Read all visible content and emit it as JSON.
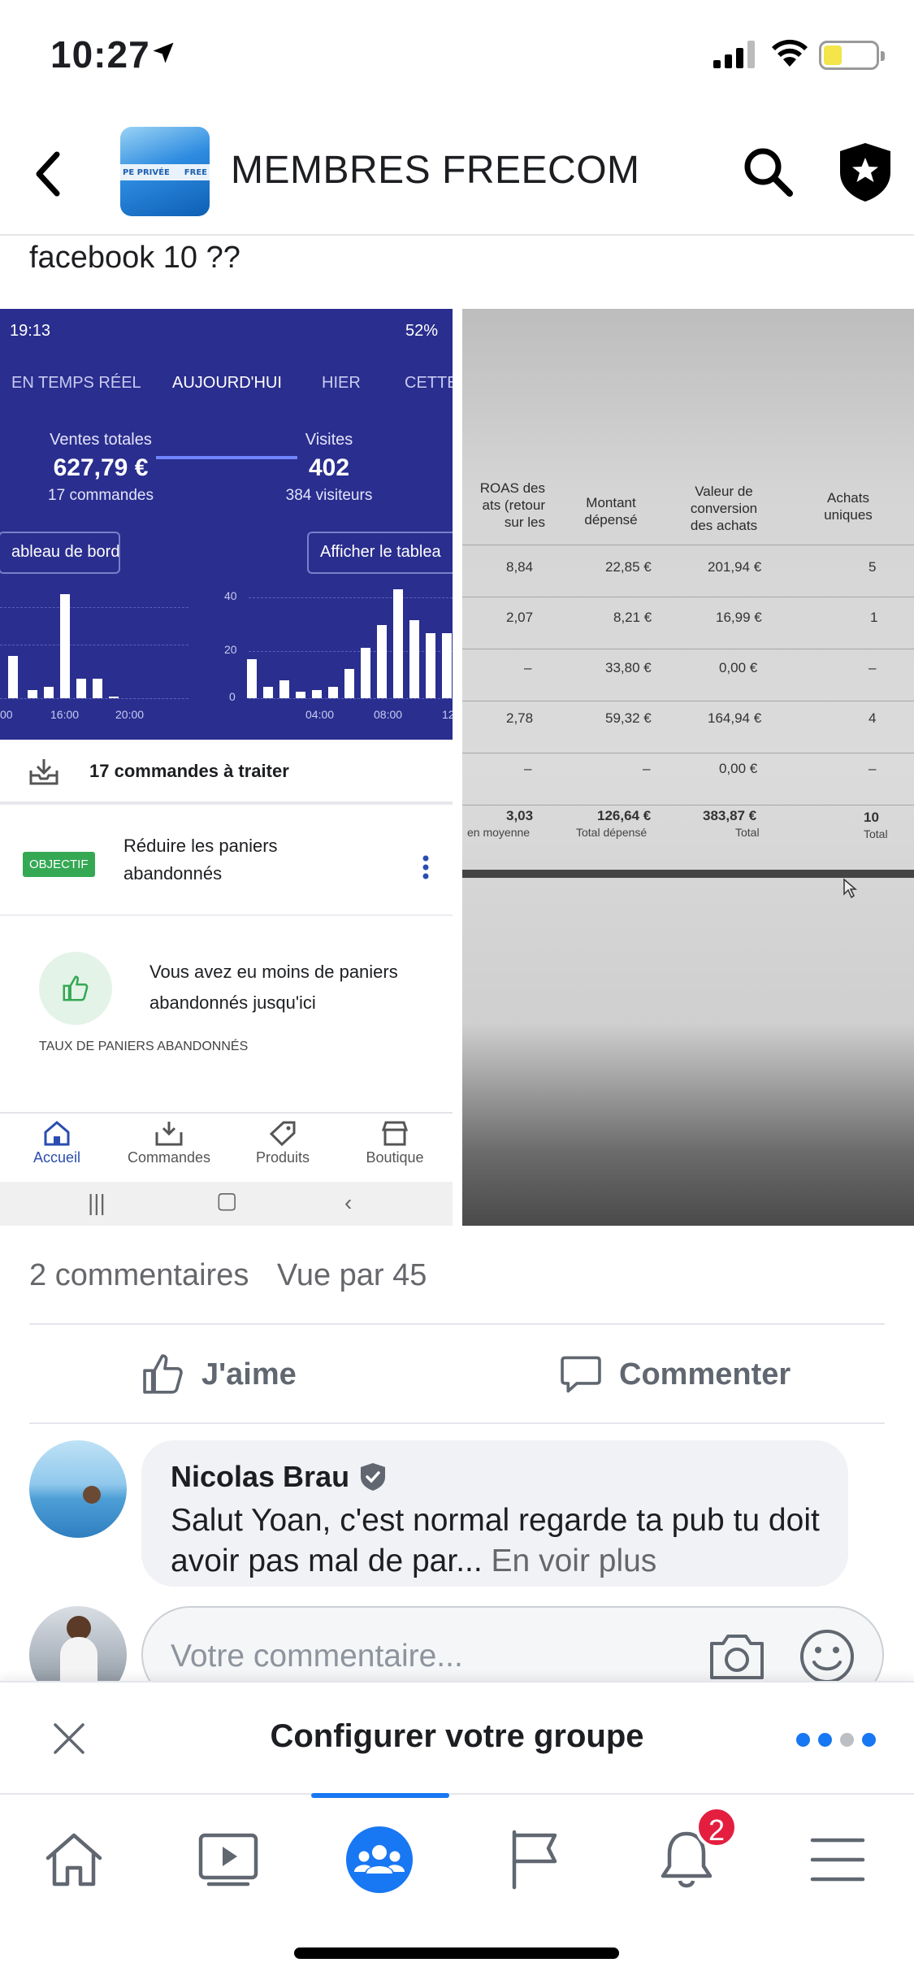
{
  "status_bar": {
    "time": "10:27"
  },
  "header": {
    "group_name": "MEMBRES FREECOM",
    "avatar_text_left": "PE PRIVÉE",
    "avatar_text_right": "FREE"
  },
  "post": {
    "text": "facebook 10 ??",
    "left_screenshot": {
      "status_time": "19:13",
      "status_right": "52%",
      "tabs": [
        "EN TEMPS RÉEL",
        "AUJOURD'HUI",
        "HIER",
        "CETTE"
      ],
      "active_tab": "AUJOURD'HUI",
      "kpi_sales": {
        "label": "Ventes totales",
        "value": "627,79 €",
        "sub": "17 commandes"
      },
      "kpi_visits": {
        "label": "Visites",
        "value": "402",
        "sub": "384 visiteurs"
      },
      "btn_dashboard": "ableau de bord",
      "btn_table": "Afficher le tablea",
      "chart_ticks_left": [
        "00",
        "16:00",
        "20:00"
      ],
      "chart_ticks_right": [
        "04:00",
        "08:00",
        "12"
      ],
      "chart_yaxis": [
        "40",
        "20",
        "0"
      ],
      "orders_to_process": "17 commandes à traiter",
      "goal_badge": "OBJECTIF",
      "goal_text": "Réduire les paniers abandonnés",
      "info_text": "Vous avez eu moins de paniers abandonnés jusqu'ici",
      "rate_label": "TAUX DE PANIERS ABANDONNÉS",
      "nav": [
        "Accueil",
        "Commandes",
        "Produits",
        "Boutique"
      ]
    },
    "right_photo": {
      "headers": [
        "ROAS des\nats (retour\nsur les",
        "Montant\ndépensé",
        "Valeur de\nconversion\ndes achats",
        "Achats\nuniques"
      ],
      "rows": [
        [
          "8,84",
          "22,85 €",
          "201,94 €",
          "5"
        ],
        [
          "2,07",
          "8,21 €",
          "16,99 €",
          "1"
        ],
        [
          "–",
          "33,80 €",
          "0,00 €",
          "–"
        ],
        [
          "2,78",
          "59,32 €",
          "164,94 €",
          "4"
        ],
        [
          "–",
          "–",
          "0,00 €",
          "–"
        ]
      ],
      "totals": [
        "3,03",
        "126,64 €",
        "383,87 €",
        "10"
      ],
      "totals_sub": [
        "en moyenne",
        "Total dépensé",
        "Total",
        "Total"
      ]
    },
    "comment_count": "2 commentaires",
    "views": "Vue par 45",
    "like_label": "J'aime",
    "comment_label": "Commenter"
  },
  "comment": {
    "author": "Nicolas Brau",
    "text": "Salut Yoan, c'est normal regarde ta pub tu doit avoir pas mal de par...",
    "see_more": "En voir plus"
  },
  "composer": {
    "placeholder": "Votre commentaire..."
  },
  "setup_banner": {
    "title": "Configurer votre groupe"
  },
  "tabbar": {
    "notifications_badge": "2"
  },
  "colors": {
    "accent": "#1877f2",
    "badge": "#e41e3f",
    "shopify_blue": "#2a2e8e",
    "objective_green": "#35a854"
  }
}
